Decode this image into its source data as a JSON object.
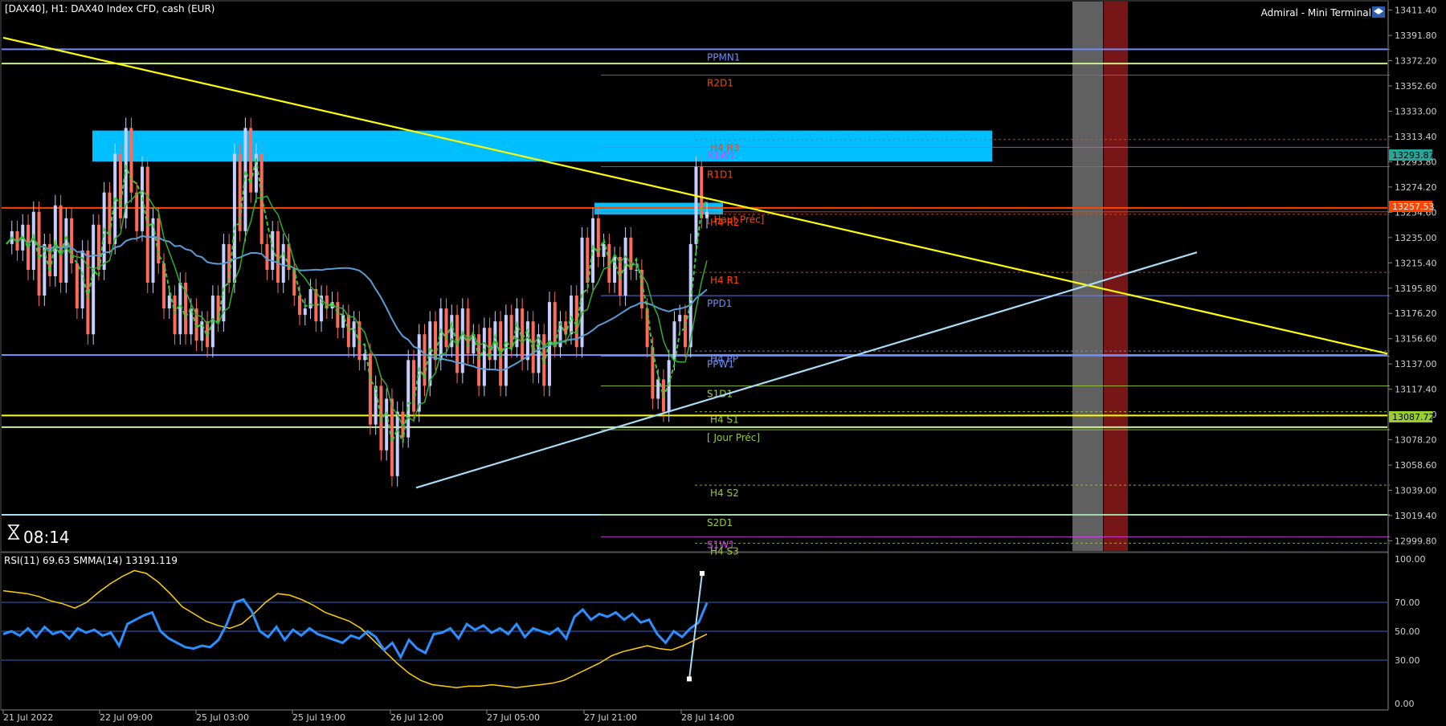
{
  "header": {
    "symbol_line": "[DAX40], H1:  DAX40 Index CFD, cash (EUR)",
    "terminal": "Admiral - Mini Terminal"
  },
  "timer": "08:14",
  "colors": {
    "background": "#000000",
    "bull": "#c6cdff",
    "bear": "#ff6b5b",
    "trend_down": "#ffff00",
    "trend_up": "#a9dcf7",
    "zone": "#00bfff",
    "rsi": "#2b8fff",
    "smma": "#ffd000",
    "ma_slow": "#5b9bd5",
    "ma_fast": "#2fae2f"
  },
  "price_badges": {
    "upper": "13293.87",
    "current": "13257.53",
    "lower": "13087.72"
  },
  "chart_data": [
    {
      "type": "candlestick",
      "symbol": "DAX40",
      "timeframe": "H1",
      "y_ticks": [
        "13411.40",
        "13391.80",
        "13372.20",
        "13352.60",
        "13333.00",
        "13313.40",
        "13293.80",
        "13274.20",
        "13254.60",
        "13235.00",
        "13215.40",
        "13195.80",
        "13176.20",
        "13156.60",
        "13137.00",
        "13117.40",
        "13097.80",
        "13078.20",
        "13058.60",
        "13039.00",
        "13019.40",
        "12999.80"
      ],
      "ylim": [
        12992.0,
        13418.0
      ],
      "x_ticks": [
        "21 Jul 2022",
        "22 Jul 09:00",
        "25 Jul 03:00",
        "25 Jul 19:00",
        "26 Jul 12:00",
        "27 Jul 05:00",
        "27 Jul 21:00",
        "28 Jul 14:00"
      ],
      "levels": [
        {
          "name": "PPMN1",
          "value": 13381,
          "color": "#6d8cff"
        },
        {
          "name": "R2D1",
          "value": 13361,
          "color": "#ff4500"
        },
        {
          "name": "H4 R3",
          "value": 13311,
          "color": "#ff4500"
        },
        {
          "name": "R1W1",
          "value": 13305,
          "color": "#e040fb"
        },
        {
          "name": "R1D1",
          "value": 13290,
          "color": "#ff4500"
        },
        {
          "name": "[ Haut Préc]",
          "value": 13255,
          "color": "#ff4500"
        },
        {
          "name": "H4 R2",
          "value": 13253,
          "color": "#ff4500"
        },
        {
          "name": "H4 R1",
          "value": 13208,
          "color": "#ff4500"
        },
        {
          "name": "PPD1",
          "value": 13190,
          "color": "#6d8cff"
        },
        {
          "name": "H4 PP",
          "value": 13147,
          "color": "#6d8cff"
        },
        {
          "name": "PPW1",
          "value": 13143,
          "color": "#6d8cff"
        },
        {
          "name": "S1D1",
          "value": 13120,
          "color": "#9acd32"
        },
        {
          "name": "H4 S1",
          "value": 13100,
          "color": "#9acd32"
        },
        {
          "name": "[ Jour Préc]",
          "value": 13086,
          "color": "#9acd32"
        },
        {
          "name": "H4 S2",
          "value": 13043,
          "color": "#9acd32"
        },
        {
          "name": "S2D1",
          "value": 13020,
          "color": "#9acd32"
        },
        {
          "name": "S1W1",
          "value": 13003,
          "color": "#e040fb"
        },
        {
          "name": "H4 S3",
          "value": 12998,
          "color": "#9acd32"
        }
      ],
      "horizontal_lines": [
        {
          "value": 13381,
          "color": "#6d8cff"
        },
        {
          "value": 13370,
          "color": "#c8f08c"
        },
        {
          "value": 13258,
          "color": "#ff4500"
        },
        {
          "value": 13144,
          "color": "#6d8cff"
        },
        {
          "value": 13097,
          "color": "#ffff00"
        },
        {
          "value": 13088,
          "color": "#c8f08c"
        },
        {
          "value": 13020,
          "color": "#a9dcf7"
        }
      ],
      "zones": [
        {
          "from": 13294,
          "to": 13318,
          "color": "#00bfff"
        },
        {
          "from": 13253,
          "to": 13262,
          "color": "#00bfff"
        }
      ],
      "trendlines": [
        {
          "from": [
            "21 Jul 2022",
            13390
          ],
          "to": [
            "28 Jul 14:00",
            13270
          ],
          "color": "#ffff00"
        },
        {
          "from": [
            "26 Jul 12:00",
            13035
          ],
          "to": [
            "28 Jul 14:00",
            13103
          ],
          "color": "#a9dcf7"
        }
      ],
      "last_price": 13257.53
    },
    {
      "type": "line",
      "title": "RSI(11) 69.63 SMMA(14) 13191.119",
      "y_ticks": [
        "100.00",
        "70.00",
        "50.00",
        "30.00",
        "0.00"
      ],
      "ylim": [
        0,
        100
      ],
      "levels": [
        70,
        50,
        30
      ],
      "series": [
        {
          "name": "RSI(11)",
          "last": 69.63
        },
        {
          "name": "SMMA(14)",
          "last": 13191.119
        }
      ]
    }
  ]
}
